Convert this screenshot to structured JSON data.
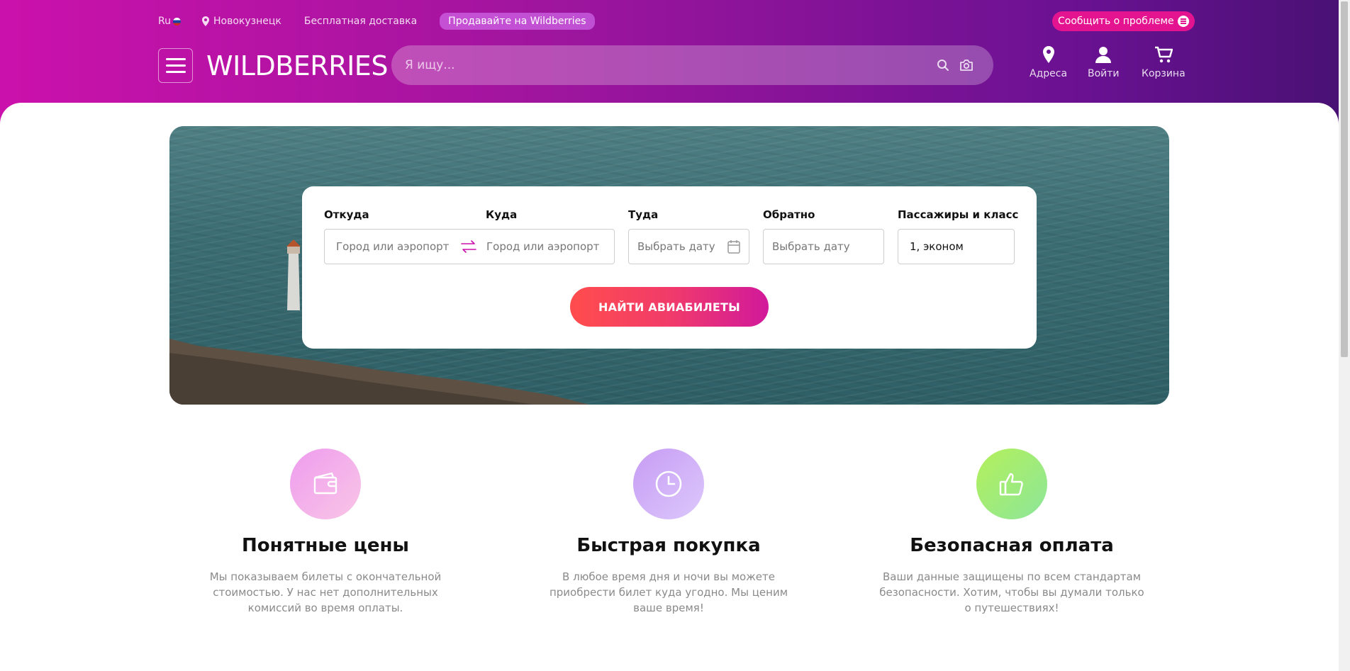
{
  "header": {
    "lang": "Ru",
    "city": "Новокузнецк",
    "free_delivery": "Бесплатная доставка",
    "sell": "Продавайте на Wildberries",
    "report": "Сообщить о проблеме",
    "logo": "WILDBERRIES",
    "search_placeholder": "Я ищу...",
    "nav": {
      "addresses": "Адреса",
      "login": "Войти",
      "cart": "Корзина"
    }
  },
  "form": {
    "from_label": "Откуда",
    "from_placeholder": "Город или аэропорт",
    "to_label": "Куда",
    "to_placeholder": "Город или аэропорт",
    "depart_label": "Туда",
    "depart_placeholder": "Выбрать дату",
    "return_label": "Обратно",
    "return_placeholder": "Выбрать дату",
    "pax_label": "Пассажиры и класс",
    "pax_value": "1, эконом",
    "submit": "НАЙТИ АВИАБИЛЕТЫ"
  },
  "features": [
    {
      "title": "Понятные цены",
      "desc": "Мы показываем билеты с окончательной стоимостью. У нас нет дополнительных комиссий во время оплаты.",
      "icon": "wallet-icon"
    },
    {
      "title": "Быстрая покупка",
      "desc": "В любое время дня и ночи вы можете приобрести билет куда угодно. Мы ценим ваше время!",
      "icon": "clock-icon"
    },
    {
      "title": "Безопасная оплата",
      "desc": "Ваши данные защищены по всем стандартам безопасности. Хотим, чтобы вы думали только о путешествиях!",
      "icon": "thumbs-up-icon"
    }
  ],
  "colors": {
    "brand_start": "#cb11ab",
    "brand_end": "#481173",
    "button_start": "#ff4d4d",
    "button_end": "#d1199b"
  }
}
